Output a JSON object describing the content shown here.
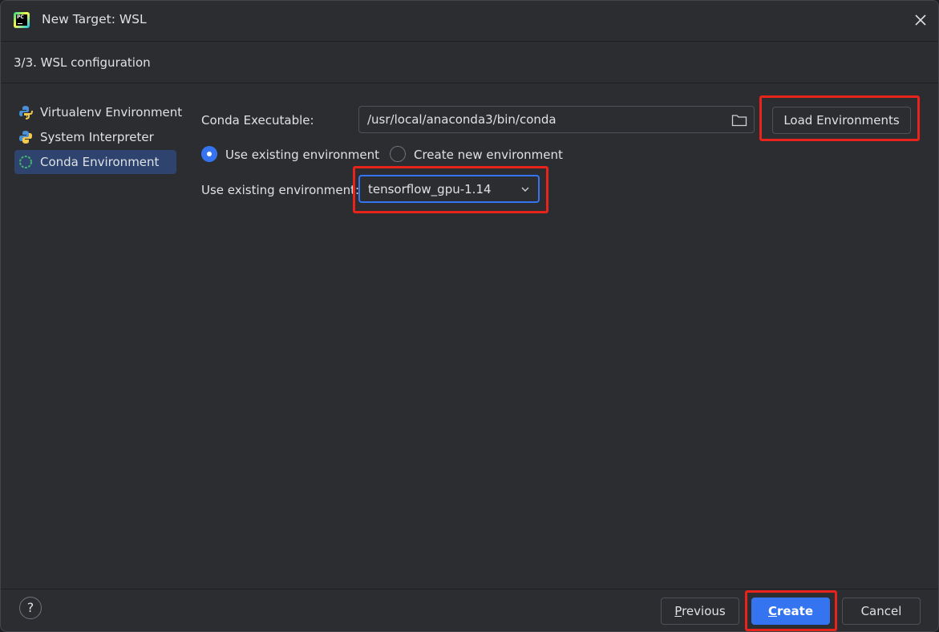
{
  "window": {
    "title": "New Target: WSL",
    "app_icon": "pycharm-logo",
    "app_icon_text": "PC",
    "close_icon": "close-icon"
  },
  "step": {
    "title": "3/3. WSL configuration"
  },
  "sidebar": {
    "items": [
      {
        "label": "Virtualenv Environment",
        "icon": "virtualenv-python-icon",
        "selected": false
      },
      {
        "label": "System Interpreter",
        "icon": "python-icon",
        "selected": false
      },
      {
        "label": "Conda Environment",
        "icon": "conda-icon",
        "selected": true
      }
    ]
  },
  "form": {
    "conda_label": "Conda Executable:",
    "conda_path": "/usr/local/anaconda3/bin/conda",
    "browse_icon": "folder-icon",
    "load_button": "Load Environments",
    "radio_existing": "Use existing environment",
    "radio_new": "Create new environment",
    "selected_radio": "existing",
    "env_label": "Use existing environment:",
    "env_value": "tensorflow_gpu-1.14",
    "dropdown_icon": "chevron-down-icon"
  },
  "footer": {
    "help": "?",
    "previous_first": "P",
    "previous_rest": "revious",
    "create_first": "C",
    "create_rest": "reate",
    "cancel": "Cancel"
  },
  "colors": {
    "accent": "#3574f0",
    "highlight": "#e8231b",
    "background": "#2b2d30",
    "selection": "#2e436e"
  }
}
